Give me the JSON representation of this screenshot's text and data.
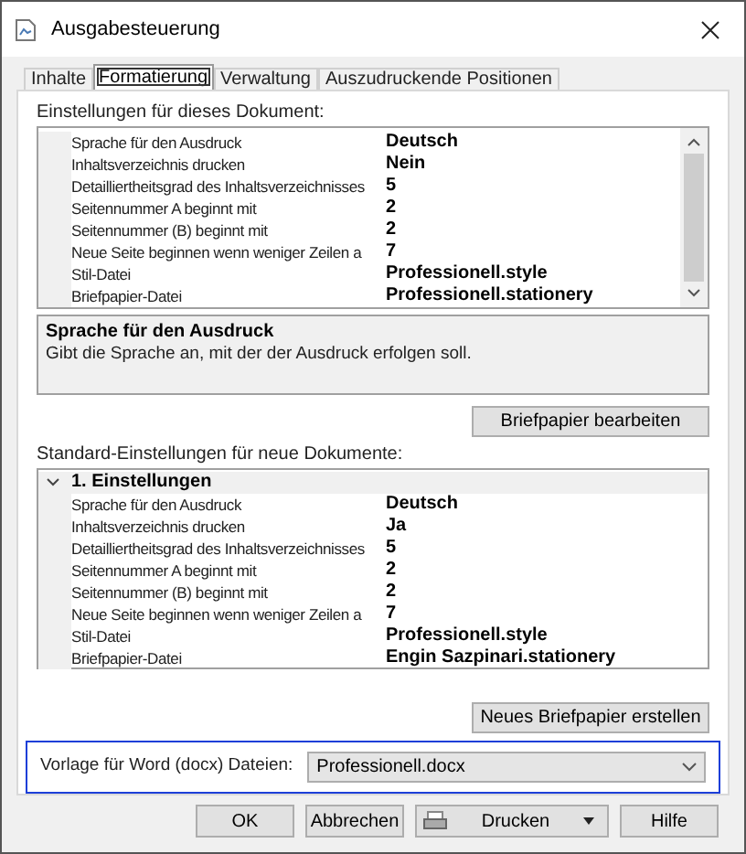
{
  "window": {
    "title": "Ausgabesteuerung"
  },
  "tabs": [
    {
      "label": "Inhalte",
      "selected": false
    },
    {
      "label": "Formatierung",
      "selected": true
    },
    {
      "label": "Verwaltung",
      "selected": false
    },
    {
      "label": "Auszudruckende Positionen",
      "selected": false
    }
  ],
  "document_settings": {
    "label": "Einstellungen für dieses Dokument:",
    "rows": [
      {
        "name": "Sprache für den Ausdruck",
        "value": "Deutsch"
      },
      {
        "name": "Inhaltsverzeichnis drucken",
        "value": "Nein"
      },
      {
        "name": "Detailliertheitsgrad des Inhaltsverzeichnisses",
        "value": "5"
      },
      {
        "name": "Seitennummer A beginnt mit",
        "value": "2"
      },
      {
        "name": "Seitennummer (B) beginnt mit",
        "value": "2"
      },
      {
        "name": "Neue Seite beginnen wenn weniger Zeilen a",
        "value": "7"
      },
      {
        "name": "Stil-Datei",
        "value": "Professionell.style"
      },
      {
        "name": "Briefpapier-Datei",
        "value": "Professionell.stationery"
      }
    ],
    "description": {
      "title": "Sprache für den Ausdruck",
      "text": "Gibt die Sprache an, mit der der Ausdruck erfolgen soll."
    },
    "button": "Briefpapier bearbeiten"
  },
  "default_settings": {
    "label": "Standard-Einstellungen für neue Dokumente:",
    "category": {
      "title": "1. Einstellungen",
      "expanded": true,
      "rows": [
        {
          "name": "Sprache für den Ausdruck",
          "value": "Deutsch"
        },
        {
          "name": "Inhaltsverzeichnis drucken",
          "value": "Ja"
        },
        {
          "name": "Detailliertheitsgrad des Inhaltsverzeichnisses",
          "value": "5"
        },
        {
          "name": "Seitennummer A beginnt mit",
          "value": "2"
        },
        {
          "name": "Seitennummer (B) beginnt mit",
          "value": "2"
        },
        {
          "name": "Neue Seite beginnen wenn weniger Zeilen a",
          "value": "7"
        },
        {
          "name": "Stil-Datei",
          "value": "Professionell.style"
        },
        {
          "name": "Briefpapier-Datei",
          "value": "Engin Sazpinari.stationery"
        }
      ]
    },
    "button": "Neues Briefpapier erstellen"
  },
  "word_template": {
    "label": "Vorlage für Word (docx) Dateien:",
    "value": "Professionell.docx"
  },
  "buttons": [
    {
      "label": "OK",
      "kind": "plain"
    },
    {
      "label": "Abbrechen",
      "kind": "plain"
    },
    {
      "label": "Drucken",
      "kind": "print"
    },
    {
      "label": "Hilfe",
      "kind": "plain"
    }
  ]
}
